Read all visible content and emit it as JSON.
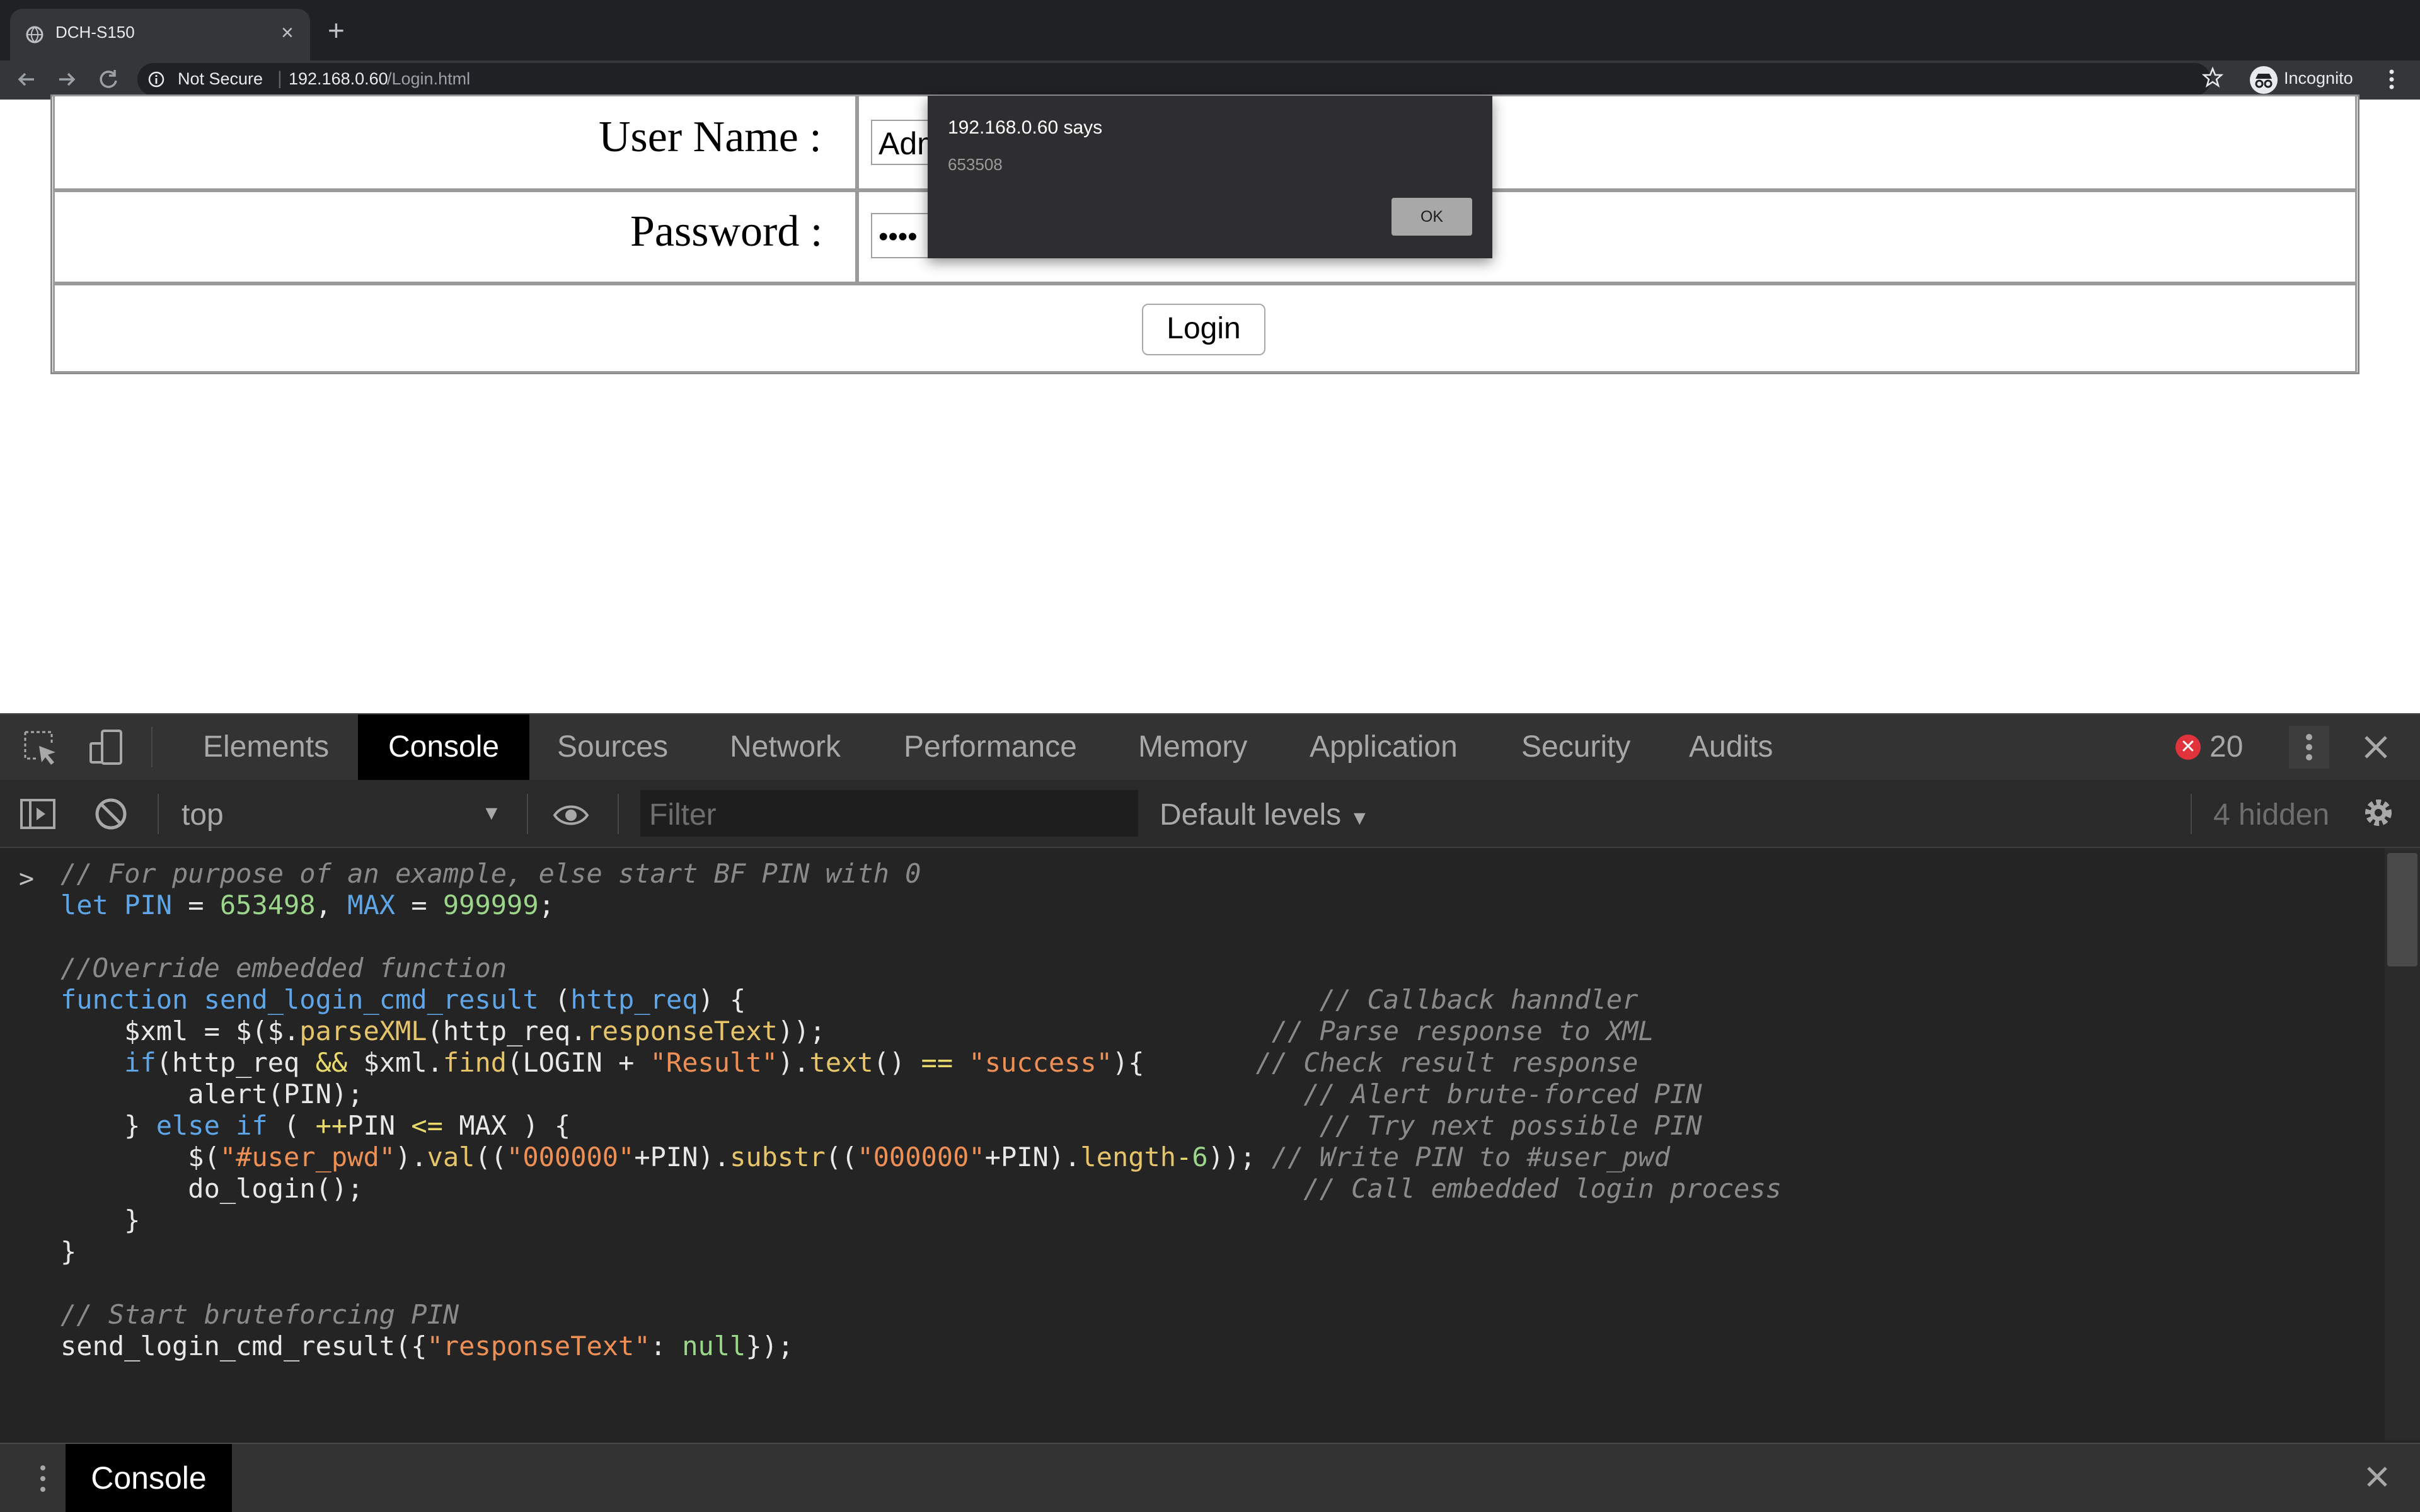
{
  "browser": {
    "tab_title": "DCH-S150",
    "tab_close": "×",
    "new_tab": "+",
    "security_label": "Not Secure",
    "url_host": "192.168.0.60",
    "url_path": "/Login.html",
    "profile_label": "Incognito"
  },
  "page": {
    "username_label": "User Name :",
    "username_value": "Admin",
    "password_label": "Password :",
    "password_value": "••••",
    "login_button": "Login"
  },
  "dialog": {
    "title": "192.168.0.60 says",
    "message": "653508",
    "ok_label": "OK"
  },
  "devtools": {
    "tabs": [
      "Elements",
      "Console",
      "Sources",
      "Network",
      "Performance",
      "Memory",
      "Application",
      "Security",
      "Audits"
    ],
    "active_tab": "Console",
    "error_count": "20",
    "context": "top",
    "filter_placeholder": "Filter",
    "levels": "Default levels",
    "hidden": "4 hidden",
    "prompt": ">",
    "drawer_tab": "Console"
  },
  "colors": {
    "chrome_dark": "#202124",
    "devtools_bg": "#242424",
    "error_red": "#e0333c",
    "keyword_blue": "#5ea6e8",
    "string_orange": "#ee8f56",
    "number_green": "#9bd68a"
  }
}
